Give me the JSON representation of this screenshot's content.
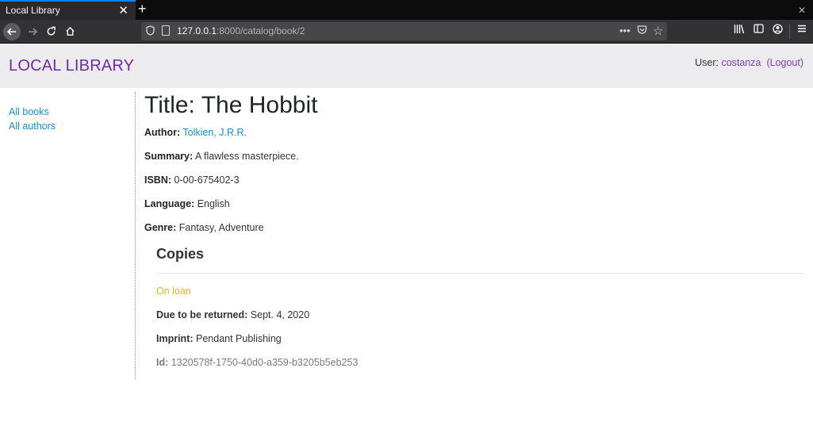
{
  "browser": {
    "tab_title": "Local Library",
    "tab_close": "✕",
    "new_tab": "+",
    "window_close": "✕",
    "url_host": "127.0.0.1",
    "url_rest": ":8000/catalog/book/2",
    "icons": [
      "back-icon",
      "forward-icon",
      "reload-icon",
      "home-icon",
      "shield-icon",
      "page-icon",
      "more-icon",
      "pocket-icon",
      "bookmark-star-icon",
      "library-icon",
      "sidebar-icon",
      "account-icon",
      "menu-icon"
    ]
  },
  "header": {
    "brand": "LOCAL LIBRARY",
    "user_prefix": "User: ",
    "username": "costanza",
    "logout": "(Logout)"
  },
  "sidebar": {
    "items": [
      {
        "label": "All books"
      },
      {
        "label": "All authors"
      }
    ]
  },
  "book": {
    "title": "Title: The Hobbit",
    "author_label": "Author:",
    "author": "Tolkien, J.R.R.",
    "summary_label": "Summary:",
    "summary": "A flawless masterpiece.",
    "isbn_label": "ISBN:",
    "isbn": "0-00-675402-3",
    "language_label": "Language:",
    "language": "English",
    "genre_label": "Genre:",
    "genre": "Fantasy, Adventure"
  },
  "copies": {
    "heading": "Copies",
    "items": [
      {
        "status": "On loan",
        "due_label": "Due to be returned:",
        "due": "Sept. 4, 2020",
        "imprint_label": "Imprint:",
        "imprint": "Pendant Publishing",
        "id_label": "Id:",
        "id": "1320578f-1750-40d0-a359-b3205b5eb253"
      }
    ]
  },
  "colors": {
    "brand": "#6f2aa4",
    "link": "#1a8cd8",
    "on_loan": "#e8b51c"
  }
}
